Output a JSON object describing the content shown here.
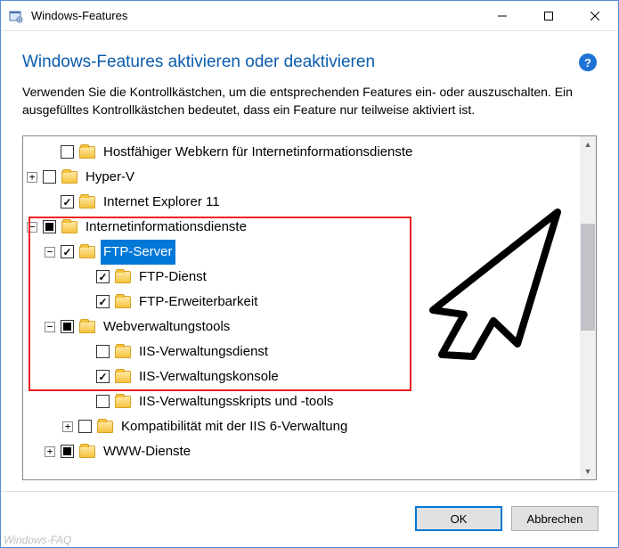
{
  "window": {
    "title": "Windows-Features"
  },
  "heading": "Windows-Features aktivieren oder deaktivieren",
  "description": "Verwenden Sie die Kontrollkästchen, um die entsprechenden Features ein- oder auszuschalten. Ein ausgefülltes Kontrollkästchen bedeutet, dass ein Feature nur teilweise aktiviert ist.",
  "tree": {
    "items": [
      {
        "indent": 1,
        "expander": "none",
        "check": "unchecked",
        "label": "Hostfähiger Webkern für Internetinformationsdienste",
        "selected": false
      },
      {
        "indent": 0,
        "expander": "plus",
        "check": "unchecked",
        "label": "Hyper-V",
        "selected": false
      },
      {
        "indent": 1,
        "expander": "none",
        "check": "checked",
        "label": "Internet Explorer 11",
        "selected": false
      },
      {
        "indent": 0,
        "expander": "minus",
        "check": "partial",
        "label": "Internetinformationsdienste",
        "selected": false
      },
      {
        "indent": 1,
        "expander": "minus",
        "check": "checked",
        "label": "FTP-Server",
        "selected": true
      },
      {
        "indent": 3,
        "expander": "none",
        "check": "checked",
        "label": "FTP-Dienst",
        "selected": false
      },
      {
        "indent": 3,
        "expander": "none",
        "check": "checked",
        "label": "FTP-Erweiterbarkeit",
        "selected": false
      },
      {
        "indent": 1,
        "expander": "minus",
        "check": "partial",
        "label": "Webverwaltungstools",
        "selected": false
      },
      {
        "indent": 3,
        "expander": "none",
        "check": "unchecked",
        "label": "IIS-Verwaltungsdienst",
        "selected": false
      },
      {
        "indent": 3,
        "expander": "none",
        "check": "checked",
        "label": "IIS-Verwaltungskonsole",
        "selected": false
      },
      {
        "indent": 3,
        "expander": "none",
        "check": "unchecked",
        "label": "IIS-Verwaltungsskripts und -tools",
        "selected": false
      },
      {
        "indent": 2,
        "expander": "plus",
        "check": "unchecked",
        "label": "Kompatibilität mit der IIS 6-Verwaltung",
        "selected": false
      },
      {
        "indent": 1,
        "expander": "plus",
        "check": "partial",
        "label": "WWW-Dienste",
        "selected": false
      }
    ]
  },
  "buttons": {
    "ok": "OK",
    "cancel": "Abbrechen"
  },
  "watermark": "Windows-FAQ"
}
